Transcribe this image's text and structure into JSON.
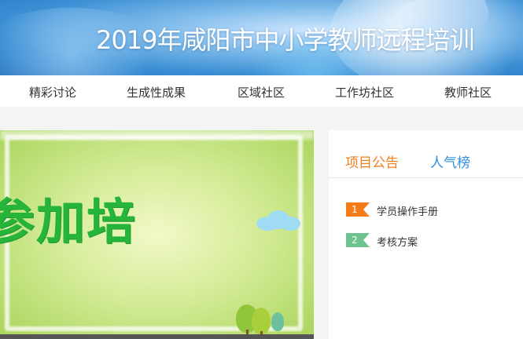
{
  "header": {
    "title": "2019年咸阳市中小学教师远程培训"
  },
  "nav": {
    "items": [
      {
        "label": "精彩讨论"
      },
      {
        "label": "生成性成果"
      },
      {
        "label": "区域社区"
      },
      {
        "label": "工作坊社区"
      },
      {
        "label": "教师社区"
      }
    ]
  },
  "hero": {
    "text": "参加培"
  },
  "panel": {
    "tabs": [
      {
        "label": "项目公告",
        "active": true
      },
      {
        "label": "人气榜",
        "active": false
      }
    ],
    "announcements": [
      {
        "rank": "1",
        "title": "学员操作手册",
        "badge_color": "#f47d1a"
      },
      {
        "rank": "2",
        "title": "考核方案",
        "badge_color": "#6cc38e"
      }
    ]
  },
  "colors": {
    "accent_orange": "#f07f1c",
    "accent_blue": "#2f8fdd",
    "hero_text_green": "#27b43a"
  }
}
